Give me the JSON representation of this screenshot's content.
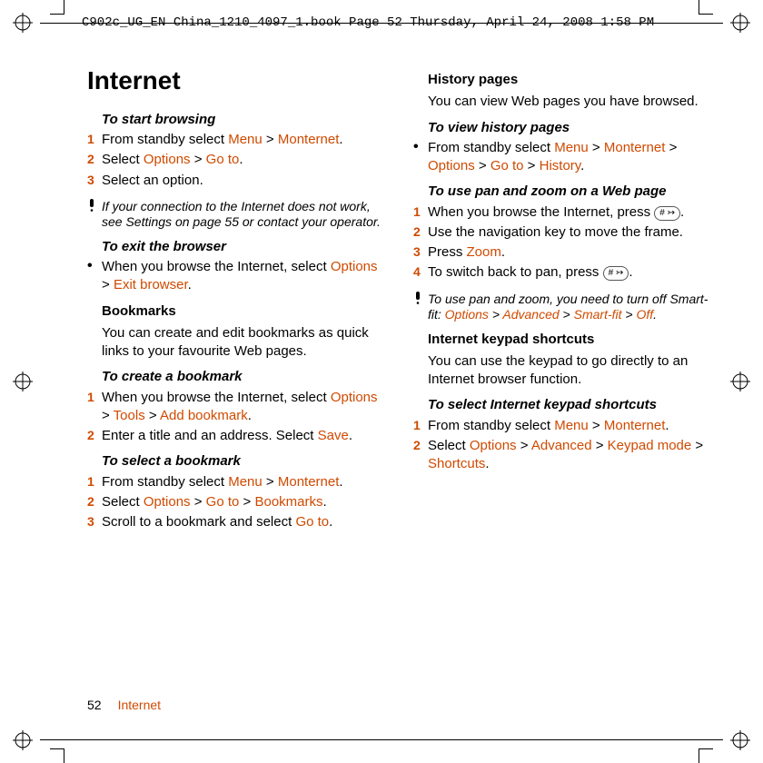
{
  "header": "C902c_UG_EN China_1210_4097_1.book  Page 52  Thursday, April 24, 2008  1:58 PM",
  "h1": "Internet",
  "gt": ">",
  "key_hash": "# ↣",
  "left": {
    "s1": {
      "h": "To start browsing",
      "l1": {
        "n": "1",
        "a": "From standby select ",
        "m": "Menu",
        "mo": "Monternet",
        "end": "."
      },
      "l2": {
        "n": "2",
        "a": "Select ",
        "o": "Options",
        "g": "Go to",
        "end": "."
      },
      "l3": {
        "n": "3",
        "a": "Select an option."
      }
    },
    "note1": "If your connection to the Internet does not work, see Settings on page 55 or contact your operator.",
    "s2": {
      "h": "To exit the browser",
      "l1": {
        "a": "When you browse the Internet, select ",
        "o": "Options",
        "e": "Exit browser",
        "end": "."
      }
    },
    "bm": {
      "h": "Bookmarks",
      "p": "You can create and edit bookmarks as quick links to your favourite Web pages."
    },
    "s3": {
      "h": "To create a bookmark",
      "l1": {
        "n": "1",
        "a": "When you browse the Internet, select ",
        "o": "Options",
        "t": "Tools",
        "ab": "Add bookmark",
        "end": "."
      },
      "l2": {
        "n": "2",
        "a": "Enter a title and an address. Select ",
        "s": "Save",
        "end": "."
      }
    },
    "s4": {
      "h": "To select a bookmark",
      "l1": {
        "n": "1",
        "a": "From standby select ",
        "m": "Menu",
        "mo": "Monternet",
        "end": "."
      },
      "l2": {
        "n": "2",
        "a": "Select ",
        "o": "Options",
        "g": "Go to",
        "b": "Bookmarks",
        "end": "."
      },
      "l3": {
        "n": "3",
        "a": "Scroll to a bookmark and select ",
        "g": "Go to",
        "end": "."
      }
    }
  },
  "right": {
    "hp": {
      "h": "History pages",
      "p": "You can view Web pages you have browsed."
    },
    "s5": {
      "h": "To view history pages",
      "l1": {
        "a": "From standby select ",
        "m": "Menu",
        "mo": "Monternet",
        "o": "Options",
        "g": "Go to",
        "hi": "History",
        "end": "."
      }
    },
    "s6": {
      "h": "To use pan and zoom on a Web page",
      "l1": {
        "n": "1",
        "a": "When you browse the Internet, press ",
        "end": "."
      },
      "l2": {
        "n": "2",
        "a": "Use the navigation key to move the frame."
      },
      "l3": {
        "n": "3",
        "a": "Press ",
        "z": "Zoom",
        "end": "."
      },
      "l4": {
        "n": "4",
        "a": "To switch back to pan, press ",
        "end": "."
      }
    },
    "note2a": "To use pan and zoom, you need to turn off Smart-fit: ",
    "note2_o": "Options",
    "note2_adv": "Advanced",
    "note2_sf": "Smart-fit",
    "note2_off": "Off",
    "note2_end": ".",
    "ks": {
      "h": "Internet keypad shortcuts",
      "p": "You can use the keypad to go directly to an Internet browser function."
    },
    "s7": {
      "h": "To select Internet keypad shortcuts",
      "l1": {
        "n": "1",
        "a": "From standby select ",
        "m": "Menu",
        "mo": "Monternet",
        "end": "."
      },
      "l2": {
        "n": "2",
        "a": "Select ",
        "o": "Options",
        "adv": "Advanced",
        "km": "Keypad mode",
        "sc": "Shortcuts",
        "end": "."
      }
    }
  },
  "footer": {
    "page": "52",
    "section": "Internet"
  }
}
